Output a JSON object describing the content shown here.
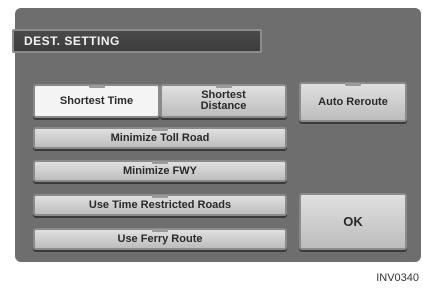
{
  "title": "DEST. SETTING",
  "buttons": {
    "shortest_time": "Shortest Time",
    "shortest_distance_line1": "Shortest",
    "shortest_distance_line2": "Distance",
    "auto_reroute": "Auto Reroute",
    "minimize_toll": "Minimize Toll Road",
    "minimize_fwy": "Minimize FWY",
    "time_restricted": "Use Time Restricted Roads",
    "ferry": "Use Ferry Route",
    "ok": "OK"
  },
  "figure_code": "INV0340"
}
